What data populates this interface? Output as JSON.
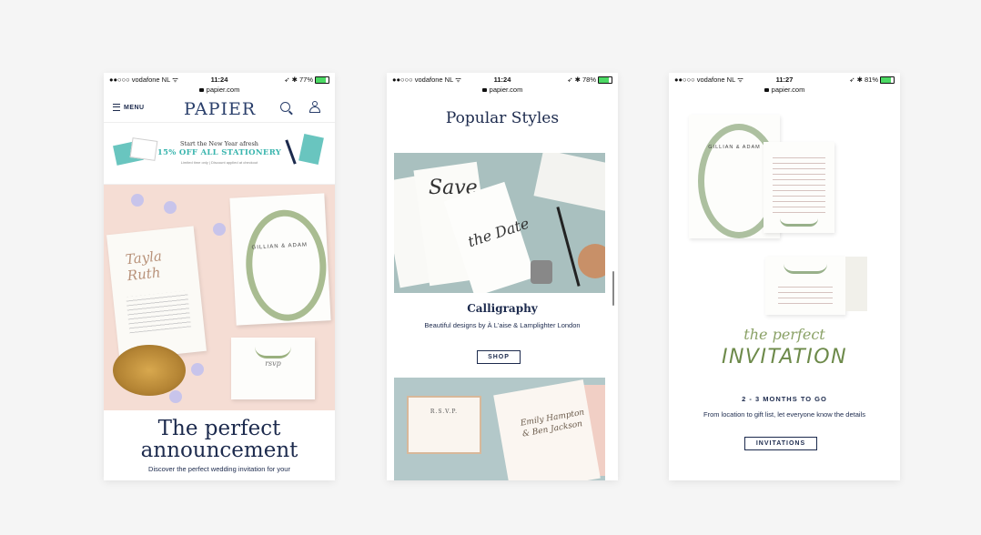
{
  "phones": [
    {
      "status": {
        "carrier": "●●○○○ vodafone NL ᯤ",
        "time": "11:24",
        "right": "➶ ✱ 77%",
        "battery": 0.77
      },
      "url": "papier.com",
      "nav": {
        "menu_label": "MENU",
        "logo": "PAPIER"
      },
      "promo": {
        "line1": "Start the New Year afresh",
        "line2": "15% OFF ALL STATIONERY",
        "line3": "Limited time only | Discount applied at checkout"
      },
      "hero": {
        "card_script": "Tayla Ruth",
        "card_names": "GILLIAN & ADAM",
        "rsvp_script": "rsvp",
        "title_line1": "The perfect",
        "title_line2": "announcement",
        "subtitle": "Discover the perfect wedding invitation for your"
      }
    },
    {
      "status": {
        "carrier": "●●○○○ vodafone NL ᯤ",
        "time": "11:24",
        "right": "➶ ✱ 78%",
        "battery": 0.78
      },
      "url": "papier.com",
      "section_title": "Popular Styles",
      "calligraphy": {
        "image_script1": "Save",
        "image_script2": "the Date",
        "title": "Calligraphy",
        "subtitle": "Beautiful designs by À L'aise & Lamplighter London",
        "button": "SHOP"
      },
      "next_card": {
        "rsvp": "R.S.V.P.",
        "script": "Emily Hampton & Ben Jackson"
      }
    },
    {
      "status": {
        "carrier": "●●○○○ vodafone NL ᯤ",
        "time": "11:27",
        "right": "➶ ✱ 81%",
        "battery": 0.81
      },
      "url": "papier.com",
      "card_names": "GILLIAN & ADAM",
      "script": "the perfect",
      "headline": "INVITATION",
      "months": "2 - 3 MONTHS TO GO",
      "text": "From location to gift list, let everyone know the details",
      "button": "INVITATIONS"
    }
  ],
  "colors": {
    "navy": "#1c2a4d",
    "teal": "#3ab5ae",
    "green": "#6d8a4a",
    "blush": "#f5ddd4"
  }
}
